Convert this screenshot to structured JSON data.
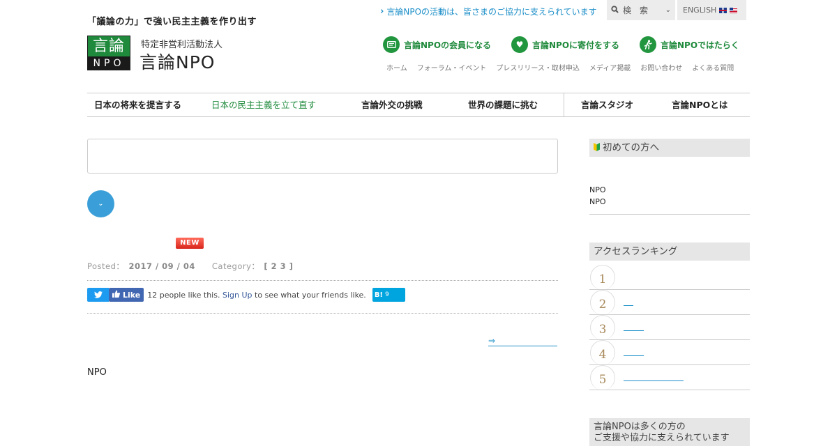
{
  "header": {
    "tagline": "「議論の力」で強い民主主義を作り出す",
    "support_link": "言論NPOの活動は、皆さまのご協力に支えられています",
    "search_label": "検　索",
    "english_label": "ENGLISH",
    "logo": {
      "top": "言論",
      "bottom": "NPO"
    },
    "org_type": "特定非営利活動法人",
    "org_name": "言論NPO",
    "actions": [
      {
        "label": "言論NPOの会員になる",
        "icon": "member-card-icon"
      },
      {
        "label": "言論NPOに寄付をする",
        "icon": "heart-icon"
      },
      {
        "label": "言論NPOではたらく",
        "icon": "runner-icon"
      }
    ],
    "subnav": [
      "ホーム",
      "フォーラム・イベント",
      "プレスリリース・取材申込",
      "メディア掲載",
      "お問い合わせ",
      "よくある質問"
    ]
  },
  "mainnav": [
    {
      "label": "日本の将来を提言する"
    },
    {
      "label": "日本の民主主義を立て直す"
    },
    {
      "label": "言論外交の挑戦"
    },
    {
      "label": "世界の課題に挑む"
    },
    {
      "label": "言論スタジオ"
    },
    {
      "label": "言論NPOとは"
    }
  ],
  "article": {
    "new_badge": "NEW",
    "posted_label": "Posted：",
    "posted_date": "2017 / 09 / 04",
    "category_label": "Category：",
    "category_value": "[ 2 3 ]",
    "social": {
      "fb_like": "Like",
      "fb_text_prefix": "12 people like this.",
      "fb_signup": "Sign Up",
      "fb_text_suffix": "to see what your friends like.",
      "hatena_label": "B!",
      "hatena_count": "9"
    },
    "arrow_link": "⇒",
    "body": "NPO"
  },
  "sidebar": {
    "beginner_title": "初めての方へ",
    "beginner_lines": [
      "NPO",
      "NPO"
    ],
    "ranking_title": "アクセスランキング",
    "ranking": [
      "1",
      "2",
      "3",
      "4",
      "5"
    ],
    "bottom_title": "言論NPOは多くの方の",
    "bottom_title2": "ご支援や協力に支えられています"
  },
  "colors": {
    "brand_green": "#1f8a3c",
    "link_blue": "#1d8fc9",
    "button_blue": "#3a9fd8"
  }
}
